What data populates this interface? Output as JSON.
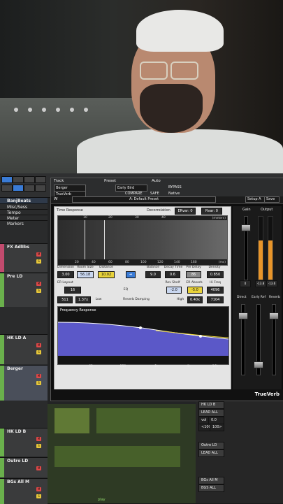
{
  "track_header": {
    "track_label": "Track",
    "preset_label": "Preset",
    "auto_label": "Auto",
    "track_name": "Berger",
    "plugin_select": "TrueVerb",
    "preset_name": "Early Bird",
    "compare": "COMPARE",
    "bypass": "BYPASS",
    "safe": "SAFE",
    "native": "Native"
  },
  "waves_bar": {
    "preset": "A: Default Preset",
    "setup": "Setup A",
    "save": "Save"
  },
  "tracks": [
    {
      "name": "BanjBeats"
    },
    {
      "name": "Misc/Sess"
    },
    {
      "name": "Tempo"
    },
    {
      "name": "Meter"
    },
    {
      "name": "Markers"
    },
    {
      "name": "FX AdlIbs"
    },
    {
      "name": "Pre LD"
    },
    {
      "name": "HK LD A"
    },
    {
      "name": "Berger"
    },
    {
      "name": "HK LD B"
    },
    {
      "name": "Outro LD"
    },
    {
      "name": "BGs All M"
    }
  ],
  "time_response": {
    "title": "Time Response",
    "decorrelation_label": "Decorrelation",
    "ervar": "ERvar: 0",
    "rvar": "Rvar: 0",
    "unit_top": "(meters)",
    "unit_bottom": "(ms)",
    "top_ticks": [
      "10",
      "20",
      "30",
      "40"
    ],
    "bottom_ticks": [
      "20",
      "40",
      "60",
      "80",
      "100",
      "120",
      "140",
      "160"
    ],
    "params": [
      {
        "label": "Dimension",
        "value": "3.00"
      },
      {
        "label": "Room Size",
        "value": "56.18"
      },
      {
        "label": "Distance",
        "value": "10.02"
      },
      {
        "label": "Balance",
        "value": "9.0"
      },
      {
        "label": "Decay Time",
        "value": "0.6"
      },
      {
        "label": "Pre Delay",
        "value": "86"
      },
      {
        "label": "Density",
        "value": "0.850"
      }
    ]
  },
  "er_section": {
    "er_layout_label": "ER Layout",
    "er_layout_value": "16",
    "eq_label": "EQ",
    "rev_shelf_label": "Rev Shelf",
    "rev_shelf_value": "-2.0",
    "er_absorb_label": "ER Absorb",
    "er_absorb_value": "-5.0",
    "hi_freq_label": "Hi Freq",
    "hi_freq_value": "4096",
    "low_left": "511",
    "low_mid": "1.37x",
    "low_label": "Low",
    "damping_label": "Reverb Damping",
    "high_label": "High",
    "high_mid": "0.40x",
    "high_right": "7104"
  },
  "frequency_response": {
    "title": "Frequency Response",
    "ticks": [
      "62",
      "250",
      "1k",
      "4k",
      "16k"
    ]
  },
  "faders": {
    "gain_label": "Gain",
    "output_label": "Output",
    "direct_label": "Direct",
    "early_ref_label": "Early Ref",
    "reverb_label": "Reverb",
    "gain_value": "0",
    "out_l": "-13.8",
    "out_r": "-13.6",
    "meter_level": 0.78
  },
  "plugin_name": "TrueVerb",
  "lanes": {
    "hk_lead": "HK LD B",
    "lead_all": "LEAD ALL",
    "outro": "Outro LD",
    "lead_all_2": "LEAD ALL",
    "bgs": "BGs All M",
    "bgs_all": "BGS ALL",
    "vol": "vol",
    "vol_value": "0.0",
    "pan": "<100",
    "pan_value": "100>"
  },
  "bottom": {
    "play": "play"
  }
}
